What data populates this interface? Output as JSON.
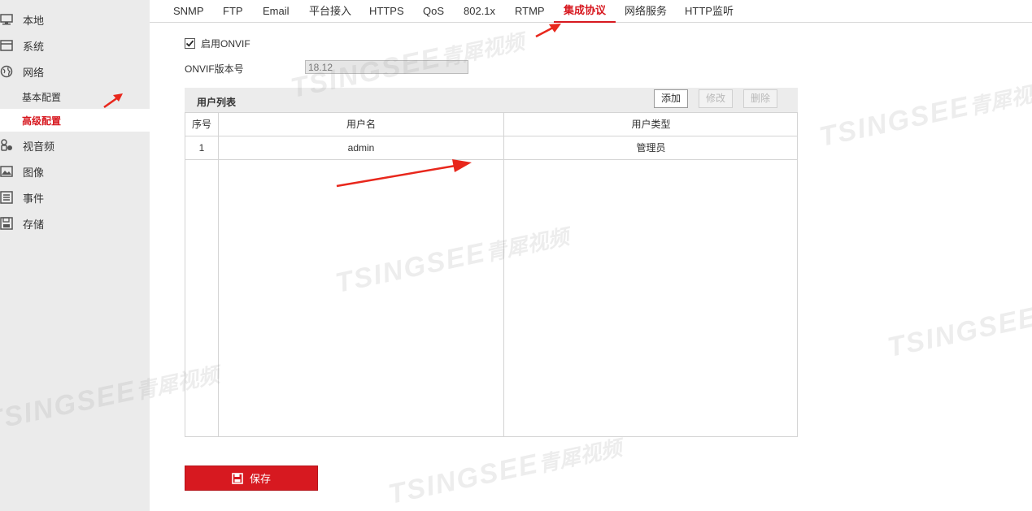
{
  "sidebar": {
    "items": [
      {
        "label": "本地",
        "icon": "monitor-icon"
      },
      {
        "label": "系统",
        "icon": "system-window-icon"
      },
      {
        "label": "网络",
        "icon": "globe-icon"
      },
      {
        "label": "视音频",
        "icon": "audio-video-icon"
      },
      {
        "label": "图像",
        "icon": "image-icon"
      },
      {
        "label": "事件",
        "icon": "event-list-icon"
      },
      {
        "label": "存储",
        "icon": "storage-icon"
      }
    ],
    "network_sub": [
      {
        "label": "基本配置",
        "active": false
      },
      {
        "label": "高级配置",
        "active": true
      }
    ]
  },
  "tabs": [
    "SNMP",
    "FTP",
    "Email",
    "平台接入",
    "HTTPS",
    "QoS",
    "802.1x",
    "RTMP",
    "集成协议",
    "网络服务",
    "HTTP监听"
  ],
  "active_tab": "集成协议",
  "form": {
    "enable_onvif_label": "启用ONVIF",
    "enable_onvif_checked": true,
    "version_label": "ONVIF版本号",
    "version_value": "18.12"
  },
  "user_list": {
    "title": "用户列表",
    "buttons": {
      "add": "添加",
      "modify": "修改",
      "delete": "删除"
    },
    "columns": [
      "序号",
      "用户名",
      "用户类型"
    ],
    "rows": [
      {
        "index": "1",
        "username": "admin",
        "type": "管理员"
      }
    ]
  },
  "save_label": "保存",
  "watermark": {
    "latin": "TSINGSEE",
    "cn": "青犀视频"
  },
  "colors": {
    "accent": "#d71920",
    "sidebar_bg": "#ebebeb",
    "annotation_arrow": "#e8271c"
  }
}
